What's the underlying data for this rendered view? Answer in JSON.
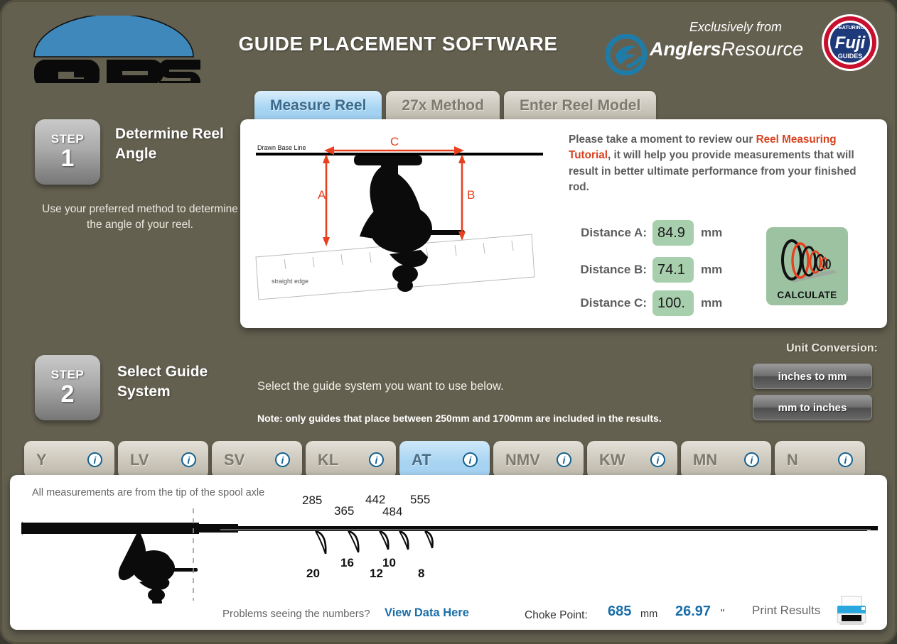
{
  "app": {
    "title": "GUIDE PLACEMENT SOFTWARE",
    "logo_text": "GPS",
    "exclusively_from": "Exclusively from",
    "brand_bold": "Anglers",
    "brand_light": "Resource",
    "fuji_top": "FEATURING",
    "fuji_main": "Fuji",
    "fuji_bottom": "GUIDES®",
    "background_color": "#646050",
    "accent_blue": "#1a6ea8",
    "accent_red": "#d9411e",
    "input_green": "#a8cfad"
  },
  "tabs": [
    {
      "label": "Measure Reel",
      "active": true
    },
    {
      "label": "27x Method",
      "active": false
    },
    {
      "label": "Enter Reel Model",
      "active": false
    }
  ],
  "step1": {
    "badge_word": "STEP",
    "badge_number": "1",
    "title": "Determine Reel Angle",
    "subtitle": "Use your preferred method to determine the angle of your reel."
  },
  "step2": {
    "badge_word": "STEP",
    "badge_number": "2",
    "title": "Select Guide System",
    "subtitle": "Select the guide system you want to use below.",
    "note": "Note: only guides that place between 250mm and 1700mm are included in the results."
  },
  "measure_panel": {
    "diagram": {
      "base_line_label": "Drawn Base Line",
      "straight_edge_label": "straight edge",
      "dim_a": "A",
      "dim_b": "B",
      "dim_c": "C"
    },
    "tutorial": {
      "part1": "Please take a moment to review our ",
      "link": "Reel Measuring Tutorial",
      "part2": ", it will help you provide measurements that will result in better ultimate performance from your finished rod."
    },
    "fields": [
      {
        "label": "Distance A:",
        "value": "84.9",
        "unit": "mm",
        "focused": true
      },
      {
        "label": "Distance B:",
        "value": "74.1",
        "unit": "mm",
        "focused": false
      },
      {
        "label": "Distance C:",
        "value": "100.",
        "unit": "mm",
        "focused": false
      }
    ],
    "calculate_label": "CALCULATE"
  },
  "unit_conversion": {
    "title": "Unit Conversion:",
    "inches_to_mm": "inches to mm",
    "mm_to_inches": "mm to inches"
  },
  "guide_systems": [
    {
      "label": "Y",
      "active": false,
      "info": "i"
    },
    {
      "label": "LV",
      "active": false,
      "info": "i"
    },
    {
      "label": "SV",
      "active": false,
      "info": "i"
    },
    {
      "label": "KL",
      "active": false,
      "info": "i"
    },
    {
      "label": "AT",
      "active": true,
      "info": "i"
    },
    {
      "label": "NMV",
      "active": false,
      "info": "i"
    },
    {
      "label": "KW",
      "active": false,
      "info": "i"
    },
    {
      "label": "MN",
      "active": false,
      "info": "i"
    },
    {
      "label": "N",
      "active": false,
      "info": "i"
    }
  ],
  "results": {
    "note": "All measurements are from the tip of the spool axle",
    "guides": [
      {
        "position_mm": "285",
        "size": "20"
      },
      {
        "position_mm": "365",
        "size": "16"
      },
      {
        "position_mm": "442",
        "size": "12"
      },
      {
        "position_mm": "484",
        "size": "10"
      },
      {
        "position_mm": "555",
        "size": "8"
      }
    ],
    "problems_text": "Problems seeing the numbers?",
    "view_data_link": "View Data Here",
    "choke_label": "Choke Point:",
    "choke_mm": "685",
    "choke_mm_unit": "mm",
    "choke_inches": "26.97",
    "choke_inches_unit": "\"",
    "print_label": "Print Results"
  }
}
